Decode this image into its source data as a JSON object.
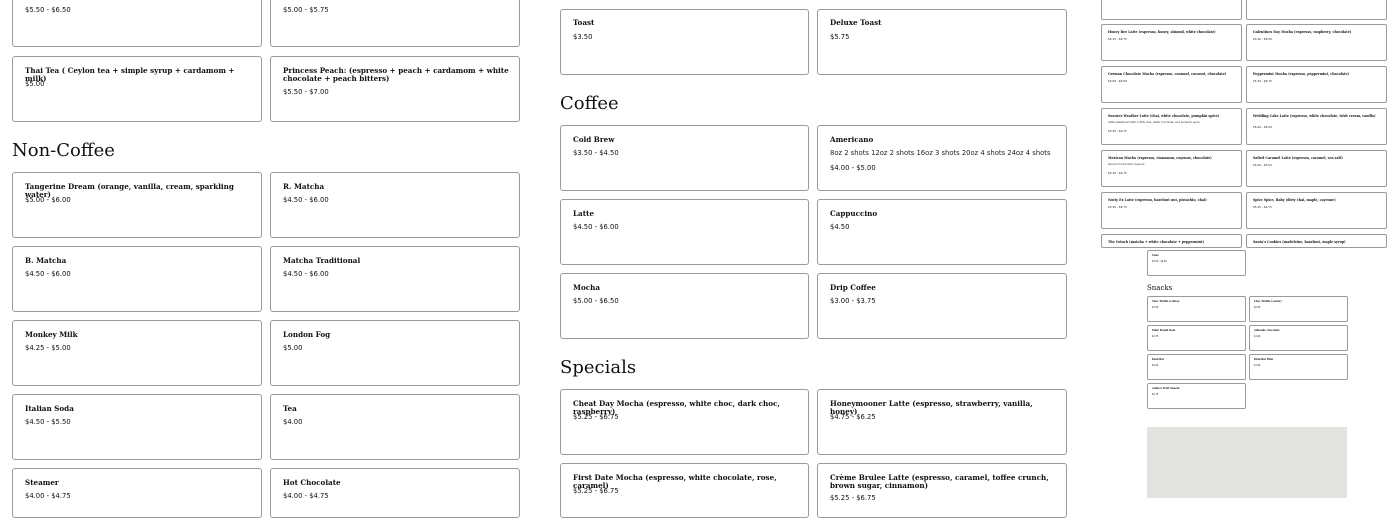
{
  "non_coffee_section": {
    "heading": "Non-Coffee",
    "top_partial": [
      {
        "price": "$5.50 - $6.50"
      },
      {
        "price": "$5.00 - $5.75"
      }
    ],
    "pre_items": [
      {
        "name": "Thai Tea ( Ceylon tea + simple syrup + cardamom + milk)",
        "price": "$5.00"
      },
      {
        "name": "Princess Peach: (espresso + peach + cardamom + white chocolate + peach bitters)",
        "price": "$5.50 - $7.00"
      }
    ],
    "items": [
      {
        "name": "Tangerine Dream (orange, vanilla, cream, sparkling water)",
        "price": "$5.00 - $6.00"
      },
      {
        "name": "R. Matcha",
        "price": "$4.50 - $6.00"
      },
      {
        "name": "B. Matcha",
        "price": "$4.50 - $6.00"
      },
      {
        "name": "Matcha Traditional",
        "price": "$4.50 - $6.00"
      },
      {
        "name": "Monkey Milk",
        "price": "$4.25 - $5.00"
      },
      {
        "name": "London Fog",
        "price": "$5.00"
      },
      {
        "name": "Italian Soda",
        "price": "$4.50 - $5.50"
      },
      {
        "name": "Tea",
        "price": "$4.00"
      },
      {
        "name": "Steamer",
        "price": "$4.00 - $4.75"
      },
      {
        "name": "Hot Chocolate",
        "price": "$4.00 - $4.75"
      }
    ]
  },
  "toast_items": [
    {
      "name": "Toast",
      "price": "$3.50"
    },
    {
      "name": "Deluxe Toast",
      "price": "$5.75"
    }
  ],
  "coffee_section": {
    "heading": "Coffee",
    "items": [
      {
        "name": "Cold Brew",
        "price": "$3.50 - $4.50"
      },
      {
        "name": "Americano",
        "desc": "8oz 2 shots 12oz 2 shots 16oz 3 shots 20oz 4 shots 24oz 4 shots",
        "price": "$4.00 - $5.00"
      },
      {
        "name": "Latte",
        "price": "$4.50 - $6.00"
      },
      {
        "name": "Cappuccino",
        "price": "$4.50"
      },
      {
        "name": "Mocha",
        "price": "$5.00 - $6.50"
      },
      {
        "name": "Drip Coffee",
        "price": "$3.00 - $3.75"
      }
    ]
  },
  "specials_section": {
    "heading": "Specials",
    "items": [
      {
        "name": "Cheat Day Mocha (espresso, white choc, dark choc, raspberry)",
        "price": "$5.25 - $6.75"
      },
      {
        "name": "Honeymooner Latte (espresso, strawberry, vanilla, honey)",
        "price": "$4.75 - $6.25"
      },
      {
        "name": "First Date Mocha (espresso, white chocolate, rose, caramel)",
        "price": "$5.25 - $6.75"
      },
      {
        "name": "Crème Brulee Latte (espresso, caramel, toffee crunch, brown sugar, cinnamon)",
        "price": "$5.25 - $6.75"
      }
    ]
  },
  "mini_panel": {
    "items": [
      {
        "name": "Honey Bee Latte (espresso, honey, almond, white chocolate)",
        "price": "$5.25 - $6.75"
      },
      {
        "name": "Galentines Day Mocha (espresso, raspberry, chocolate)",
        "price": "$5.00 - $6.50"
      },
      {
        "name": "German Chocolate Mocha (espresso, caramel, coconut, chocolate)",
        "price": "$5.00 - $6.50"
      },
      {
        "name": "Peppermint Mocha (espresso, peppermint, chocolate)",
        "price": "$5.25 - $6.75"
      },
      {
        "name": "Sweater Weather Latte (chai, white chocolate, pumpkin spice)",
        "desc": "Latte sweetened with a little chai, white chocolate, and pumpkin spice.",
        "price": "$5.25 - $6.75"
      },
      {
        "name": "Wedding Cake Latte (espresso, white chocolate, irish cream, vanilla)",
        "price": "$5.00 - $6.50"
      },
      {
        "name": "Mexican Mocha (espresso, cinnamon, cayenne, chocolate)",
        "desc": "Spiced mocha with cayenne",
        "price": "$5.25 - $6.75"
      },
      {
        "name": "Salted Caramel Latte (espresso, caramel, sea salt)",
        "price": "$5.00 - $6.50"
      },
      {
        "name": "Nutty Ex Latte (espresso, hazelnut nut, pistachio, chai)",
        "price": "$5.25 - $6.75"
      },
      {
        "name": "Spice Spice, Baby (dirty chai, maple, cayenne)",
        "price": "$5.25 - $6.75"
      },
      {
        "name": "The Grinch (matcha + white chocolate + peppermint)",
        "price": ""
      },
      {
        "name": "Santa's Cookies (madeleine, hazelnut, maple syrup)",
        "price": ""
      }
    ],
    "cake": {
      "name": "Cake",
      "price": "$3.50 - $4.00"
    },
    "snacks_heading": "Snacks",
    "snacks": [
      {
        "name": "Choc Truffle (coffee)",
        "price": "$2.50"
      },
      {
        "name": "Choc Truffle (caster)",
        "price": "$2.50"
      },
      {
        "name": "Plain Pound Item",
        "price": "$2.75"
      },
      {
        "name": "Almondo chocolate",
        "price": "$1.00"
      },
      {
        "name": "Kind Bar",
        "price": "$2.00"
      },
      {
        "name": "Kind Bar Mini",
        "price": "$1.00"
      },
      {
        "name": "Annie's Fruit Snacks",
        "price": "$0.75"
      }
    ]
  }
}
